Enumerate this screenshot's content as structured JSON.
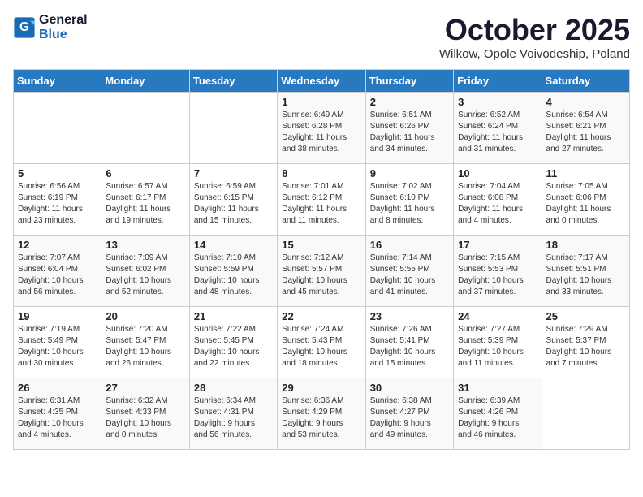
{
  "header": {
    "logo_line1": "General",
    "logo_line2": "Blue",
    "month": "October 2025",
    "location": "Wilkow, Opole Voivodeship, Poland"
  },
  "days_of_week": [
    "Sunday",
    "Monday",
    "Tuesday",
    "Wednesday",
    "Thursday",
    "Friday",
    "Saturday"
  ],
  "weeks": [
    [
      {
        "day": "",
        "info": ""
      },
      {
        "day": "",
        "info": ""
      },
      {
        "day": "",
        "info": ""
      },
      {
        "day": "1",
        "info": "Sunrise: 6:49 AM\nSunset: 6:28 PM\nDaylight: 11 hours\nand 38 minutes."
      },
      {
        "day": "2",
        "info": "Sunrise: 6:51 AM\nSunset: 6:26 PM\nDaylight: 11 hours\nand 34 minutes."
      },
      {
        "day": "3",
        "info": "Sunrise: 6:52 AM\nSunset: 6:24 PM\nDaylight: 11 hours\nand 31 minutes."
      },
      {
        "day": "4",
        "info": "Sunrise: 6:54 AM\nSunset: 6:21 PM\nDaylight: 11 hours\nand 27 minutes."
      }
    ],
    [
      {
        "day": "5",
        "info": "Sunrise: 6:56 AM\nSunset: 6:19 PM\nDaylight: 11 hours\nand 23 minutes."
      },
      {
        "day": "6",
        "info": "Sunrise: 6:57 AM\nSunset: 6:17 PM\nDaylight: 11 hours\nand 19 minutes."
      },
      {
        "day": "7",
        "info": "Sunrise: 6:59 AM\nSunset: 6:15 PM\nDaylight: 11 hours\nand 15 minutes."
      },
      {
        "day": "8",
        "info": "Sunrise: 7:01 AM\nSunset: 6:12 PM\nDaylight: 11 hours\nand 11 minutes."
      },
      {
        "day": "9",
        "info": "Sunrise: 7:02 AM\nSunset: 6:10 PM\nDaylight: 11 hours\nand 8 minutes."
      },
      {
        "day": "10",
        "info": "Sunrise: 7:04 AM\nSunset: 6:08 PM\nDaylight: 11 hours\nand 4 minutes."
      },
      {
        "day": "11",
        "info": "Sunrise: 7:05 AM\nSunset: 6:06 PM\nDaylight: 11 hours\nand 0 minutes."
      }
    ],
    [
      {
        "day": "12",
        "info": "Sunrise: 7:07 AM\nSunset: 6:04 PM\nDaylight: 10 hours\nand 56 minutes."
      },
      {
        "day": "13",
        "info": "Sunrise: 7:09 AM\nSunset: 6:02 PM\nDaylight: 10 hours\nand 52 minutes."
      },
      {
        "day": "14",
        "info": "Sunrise: 7:10 AM\nSunset: 5:59 PM\nDaylight: 10 hours\nand 48 minutes."
      },
      {
        "day": "15",
        "info": "Sunrise: 7:12 AM\nSunset: 5:57 PM\nDaylight: 10 hours\nand 45 minutes."
      },
      {
        "day": "16",
        "info": "Sunrise: 7:14 AM\nSunset: 5:55 PM\nDaylight: 10 hours\nand 41 minutes."
      },
      {
        "day": "17",
        "info": "Sunrise: 7:15 AM\nSunset: 5:53 PM\nDaylight: 10 hours\nand 37 minutes."
      },
      {
        "day": "18",
        "info": "Sunrise: 7:17 AM\nSunset: 5:51 PM\nDaylight: 10 hours\nand 33 minutes."
      }
    ],
    [
      {
        "day": "19",
        "info": "Sunrise: 7:19 AM\nSunset: 5:49 PM\nDaylight: 10 hours\nand 30 minutes."
      },
      {
        "day": "20",
        "info": "Sunrise: 7:20 AM\nSunset: 5:47 PM\nDaylight: 10 hours\nand 26 minutes."
      },
      {
        "day": "21",
        "info": "Sunrise: 7:22 AM\nSunset: 5:45 PM\nDaylight: 10 hours\nand 22 minutes."
      },
      {
        "day": "22",
        "info": "Sunrise: 7:24 AM\nSunset: 5:43 PM\nDaylight: 10 hours\nand 18 minutes."
      },
      {
        "day": "23",
        "info": "Sunrise: 7:26 AM\nSunset: 5:41 PM\nDaylight: 10 hours\nand 15 minutes."
      },
      {
        "day": "24",
        "info": "Sunrise: 7:27 AM\nSunset: 5:39 PM\nDaylight: 10 hours\nand 11 minutes."
      },
      {
        "day": "25",
        "info": "Sunrise: 7:29 AM\nSunset: 5:37 PM\nDaylight: 10 hours\nand 7 minutes."
      }
    ],
    [
      {
        "day": "26",
        "info": "Sunrise: 6:31 AM\nSunset: 4:35 PM\nDaylight: 10 hours\nand 4 minutes."
      },
      {
        "day": "27",
        "info": "Sunrise: 6:32 AM\nSunset: 4:33 PM\nDaylight: 10 hours\nand 0 minutes."
      },
      {
        "day": "28",
        "info": "Sunrise: 6:34 AM\nSunset: 4:31 PM\nDaylight: 9 hours\nand 56 minutes."
      },
      {
        "day": "29",
        "info": "Sunrise: 6:36 AM\nSunset: 4:29 PM\nDaylight: 9 hours\nand 53 minutes."
      },
      {
        "day": "30",
        "info": "Sunrise: 6:38 AM\nSunset: 4:27 PM\nDaylight: 9 hours\nand 49 minutes."
      },
      {
        "day": "31",
        "info": "Sunrise: 6:39 AM\nSunset: 4:26 PM\nDaylight: 9 hours\nand 46 minutes."
      },
      {
        "day": "",
        "info": ""
      }
    ]
  ]
}
